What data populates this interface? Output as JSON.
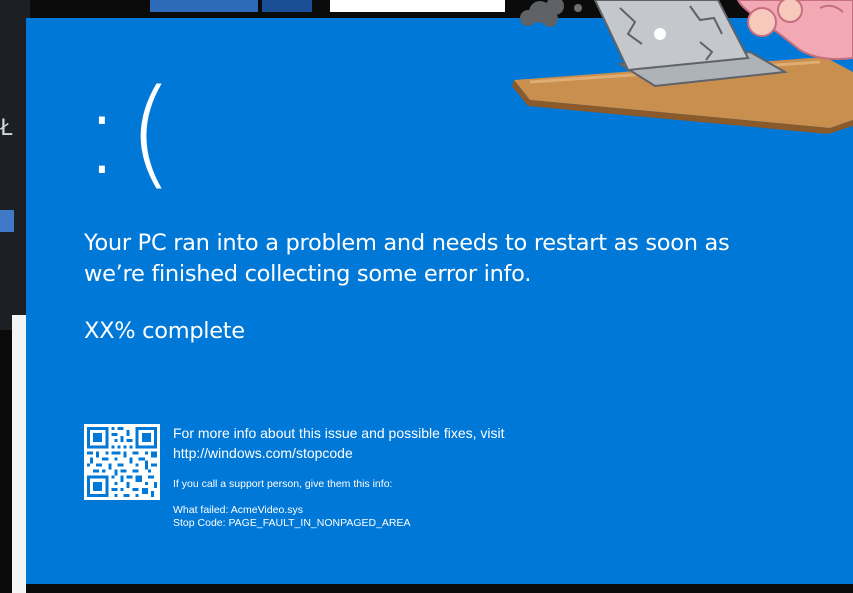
{
  "bsod": {
    "sad_face": ":(",
    "headline_line1": "Your PC ran into a problem and needs to restart as soon as",
    "headline_line2": "we’re finished collecting some error info.",
    "progress_text": "XX% complete",
    "more_info_line1": "For more info about this issue and possible fixes, visit",
    "more_info_url": "http://windows.com/stopcode",
    "support_text": "If you call a support person, give them this info:",
    "what_failed": "What failed: AcmeVideo.sys",
    "stop_code": "Stop Code: PAGE_FAULT_IN_NONPAGED_AREA",
    "background_color": "#0078d7",
    "text_color": "#ffffff"
  },
  "background": {
    "left_glyph": "Ł"
  },
  "illustration": {
    "laptop_icon": "broken-laptop-icon",
    "desk_color": "#c98f4f",
    "laptop_color": "#c4c8cc",
    "person_color": "#f2a9b3"
  }
}
